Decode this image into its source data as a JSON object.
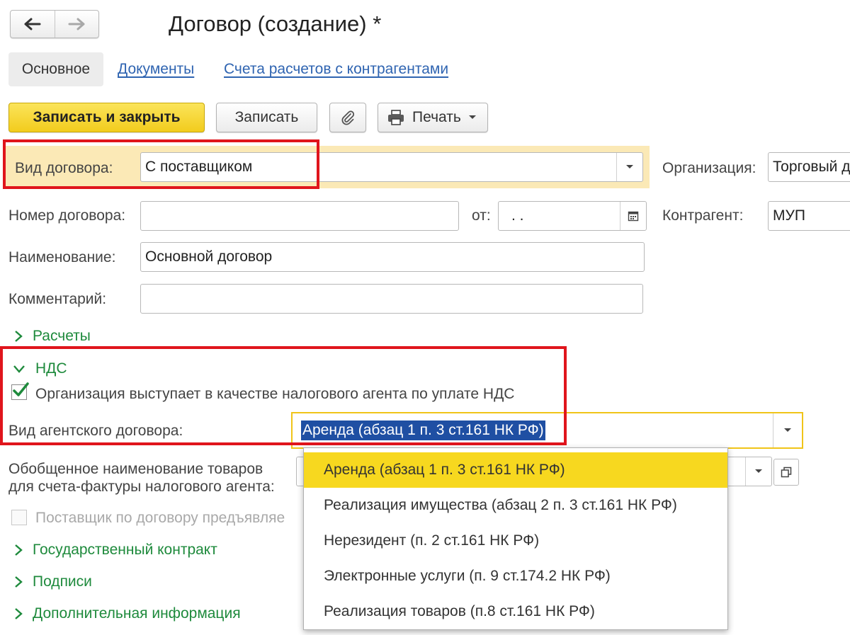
{
  "window": {
    "title": "Договор (создание) *"
  },
  "tabs": [
    {
      "label": "Основное"
    },
    {
      "label": "Документы"
    },
    {
      "label": "Счета расчетов с контрагентами"
    }
  ],
  "toolbar": {
    "save_close_label": "Записать и закрыть",
    "save_label": "Записать",
    "print_label": "Печать"
  },
  "form": {
    "contract_type_label": "Вид договора:",
    "contract_type_value": "С поставщиком",
    "organization_label": "Организация:",
    "organization_value": "Торговый д",
    "number_label": "Номер договора:",
    "number_value": "",
    "date_from_label": "от:",
    "date_value": " .  .",
    "counterparty_label": "Контрагент:",
    "counterparty_value": "МУП",
    "name_label": "Наименование:",
    "name_value": "Основной договор",
    "comment_label": "Комментарий:",
    "comment_value": ""
  },
  "sections": {
    "payments": "Расчеты",
    "vat": "НДС",
    "state_contract": "Государственный контракт",
    "signatures": "Подписи",
    "additional": "Дополнительная информация"
  },
  "vat": {
    "tax_agent_checkbox_label": "Организация выступает в качестве налогового агента по уплате НДС",
    "tax_agent_checked": true,
    "agent_contract_type_label": "Вид агентского договора:",
    "agent_contract_type_value": "Аренда (абзац 1 п. 3 ст.161 НК РФ)",
    "goods_name_label_line1": "Обобщенное наименование товаров",
    "goods_name_label_line2": "для счета-фактуры налогового агента:",
    "supplier_checkbox_label": "Поставщик по договору предъявляе",
    "supplier_checked": false
  },
  "dropdown": {
    "options": [
      "Аренда (абзац 1 п. 3 ст.161 НК РФ)",
      "Реализация имущества (абзац 2 п. 3 ст.161 НК РФ)",
      "Нерезидент (п. 2 ст.161 НК РФ)",
      "Электронные услуги (п. 9 ст.174.2 НК РФ)",
      "Реализация товаров (п.8 ст.161 НК РФ)"
    ],
    "selected_index": 0
  },
  "colors": {
    "highlight_red": "#e0151c",
    "section_green": "#1e8a3c",
    "link_blue": "#2f64b1",
    "primary_yellow": "#f7d81f",
    "selection_blue": "#1f4fa3"
  }
}
